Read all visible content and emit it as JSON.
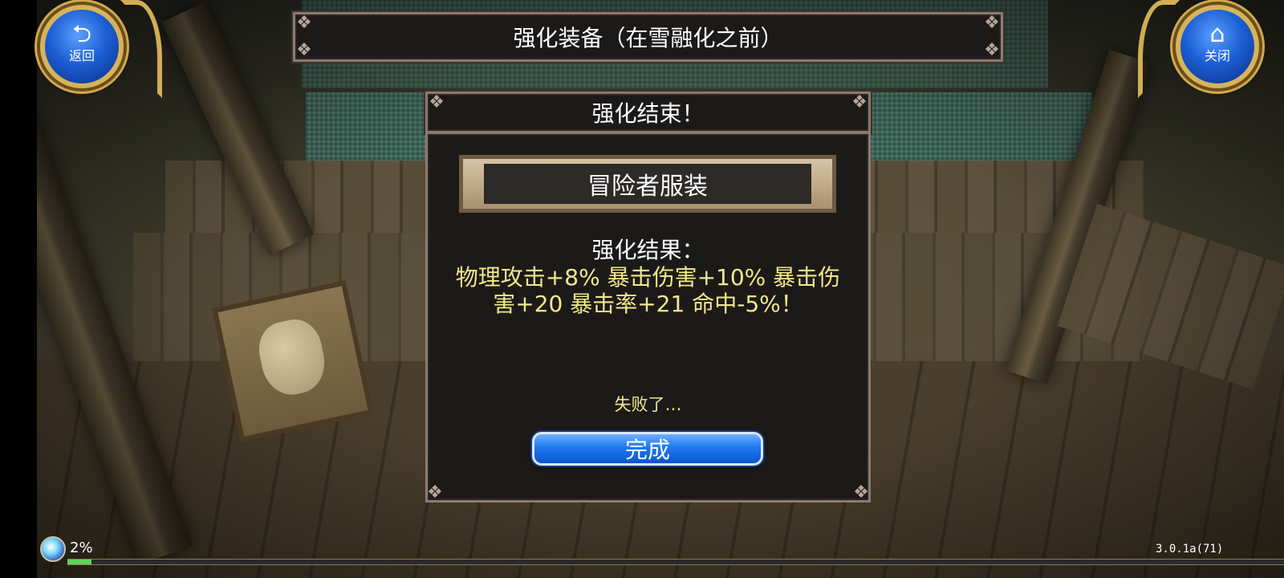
{
  "top_bar": {
    "title": "强化装备（在雪融化之前）"
  },
  "corner_buttons": {
    "back": {
      "icon": "back-arrow-icon",
      "glyph": "⮌",
      "label": "返回"
    },
    "close": {
      "icon": "home-icon",
      "glyph": "⌂",
      "label": "关闭"
    }
  },
  "dialog": {
    "header": "强化结束！",
    "item_name": "冒险者服装",
    "result_label": "强化结果：",
    "result_detail": "物理攻击+8% 暴击伤害+10% 暴击伤害+20 暴击率+21 命中-5%！",
    "fail_text": "失败了…",
    "done_label": "完成"
  },
  "hud": {
    "exp_icon": "exp-orb-icon",
    "exp_percent_label": "2%",
    "exp_progress": 0.02,
    "version": "3.0.1a(71)"
  },
  "colors": {
    "highlight_text": "#f2e88a",
    "button_blue": "#1e78f0",
    "frame_border": "#8c7a6a",
    "panel_bg": "#1c1a19",
    "gold_ring": "#d7b35a"
  }
}
